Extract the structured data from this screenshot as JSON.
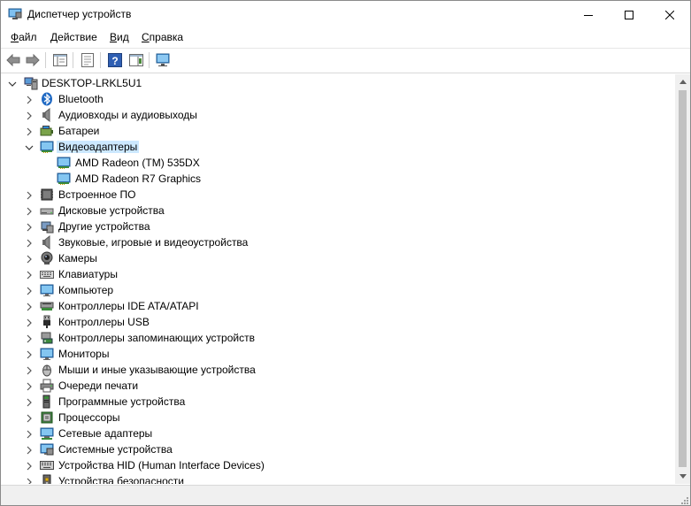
{
  "window": {
    "title": "Диспетчер устройств"
  },
  "menu": [
    {
      "name": "file",
      "u": "Ф",
      "rest": "айл"
    },
    {
      "name": "action",
      "u": "Д",
      "rest": "ействие"
    },
    {
      "name": "view",
      "u": "В",
      "rest": "ид"
    },
    {
      "name": "help",
      "u": "С",
      "rest": "правка"
    }
  ],
  "tree": {
    "root": "DESKTOP-LRKL5U1",
    "items": [
      {
        "label": "Bluetooth",
        "icon": "bluetooth-icon"
      },
      {
        "label": "Аудиовходы и аудиовыходы",
        "icon": "speaker-icon"
      },
      {
        "label": "Батареи",
        "icon": "battery-icon"
      },
      {
        "label": "Видеоадаптеры",
        "icon": "display-adapter-icon",
        "expanded": true,
        "selected": true,
        "children": [
          {
            "label": "AMD Radeon (TM) 535DX",
            "icon": "display-adapter-icon"
          },
          {
            "label": "AMD Radeon R7 Graphics",
            "icon": "display-adapter-icon"
          }
        ]
      },
      {
        "label": "Встроенное ПО",
        "icon": "firmware-icon"
      },
      {
        "label": "Дисковые устройства",
        "icon": "disk-drive-icon"
      },
      {
        "label": "Другие устройства",
        "icon": "other-devices-icon"
      },
      {
        "label": "Звуковые, игровые и видеоустройства",
        "icon": "speaker-icon"
      },
      {
        "label": "Камеры",
        "icon": "camera-icon"
      },
      {
        "label": "Клавиатуры",
        "icon": "keyboard-icon"
      },
      {
        "label": "Компьютер",
        "icon": "monitor-icon"
      },
      {
        "label": "Контроллеры IDE ATA/ATAPI",
        "icon": "ide-controller-icon"
      },
      {
        "label": "Контроллеры USB",
        "icon": "usb-icon"
      },
      {
        "label": "Контроллеры запоминающих устройств",
        "icon": "storage-controller-icon"
      },
      {
        "label": "Мониторы",
        "icon": "monitor-icon"
      },
      {
        "label": "Мыши и иные указывающие устройства",
        "icon": "mouse-icon"
      },
      {
        "label": "Очереди печати",
        "icon": "printer-icon"
      },
      {
        "label": "Программные устройства",
        "icon": "software-device-icon"
      },
      {
        "label": "Процессоры",
        "icon": "processor-icon"
      },
      {
        "label": "Сетевые адаптеры",
        "icon": "network-adapter-icon"
      },
      {
        "label": "Системные устройства",
        "icon": "system-devices-icon"
      },
      {
        "label": "Устройства HID (Human Interface Devices)",
        "icon": "hid-icon"
      },
      {
        "label": "Устройства безопасности",
        "icon": "security-device-icon"
      }
    ]
  }
}
